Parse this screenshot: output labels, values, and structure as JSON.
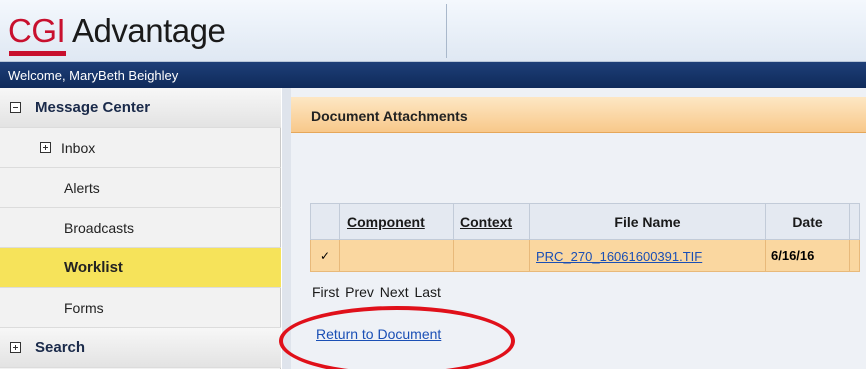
{
  "app": {
    "logo_brand": "CGI",
    "logo_product": "Advantage",
    "welcome_text": "Welcome, MaryBeth Beighley",
    "brand_color": "#c8102e"
  },
  "sidebar": {
    "items": [
      {
        "label": "Message Center",
        "kind": "section",
        "toggle": "minus"
      },
      {
        "label": "Inbox",
        "kind": "child",
        "toggle": "plus"
      },
      {
        "label": "Alerts",
        "kind": "child"
      },
      {
        "label": "Broadcasts",
        "kind": "child"
      },
      {
        "label": "Worklist",
        "kind": "child",
        "selected": true
      },
      {
        "label": "Forms",
        "kind": "child"
      },
      {
        "label": "Search",
        "kind": "section",
        "toggle": "plus"
      }
    ]
  },
  "main": {
    "panel_title": "Document Attachments",
    "table": {
      "headers": [
        "",
        "Component",
        "Context",
        "File Name",
        "Date",
        ""
      ],
      "rows": [
        {
          "check": "✓",
          "component": "",
          "context": "",
          "file_name": "PRC_270_16061600391.TIF",
          "date": "6/16/16"
        }
      ]
    },
    "pager": [
      "First",
      "Prev",
      "Next",
      "Last"
    ],
    "return_link": "Return to Document"
  },
  "annotation": {
    "color": "#e0101a",
    "shape": "ellipse",
    "target": "Return to Document"
  }
}
